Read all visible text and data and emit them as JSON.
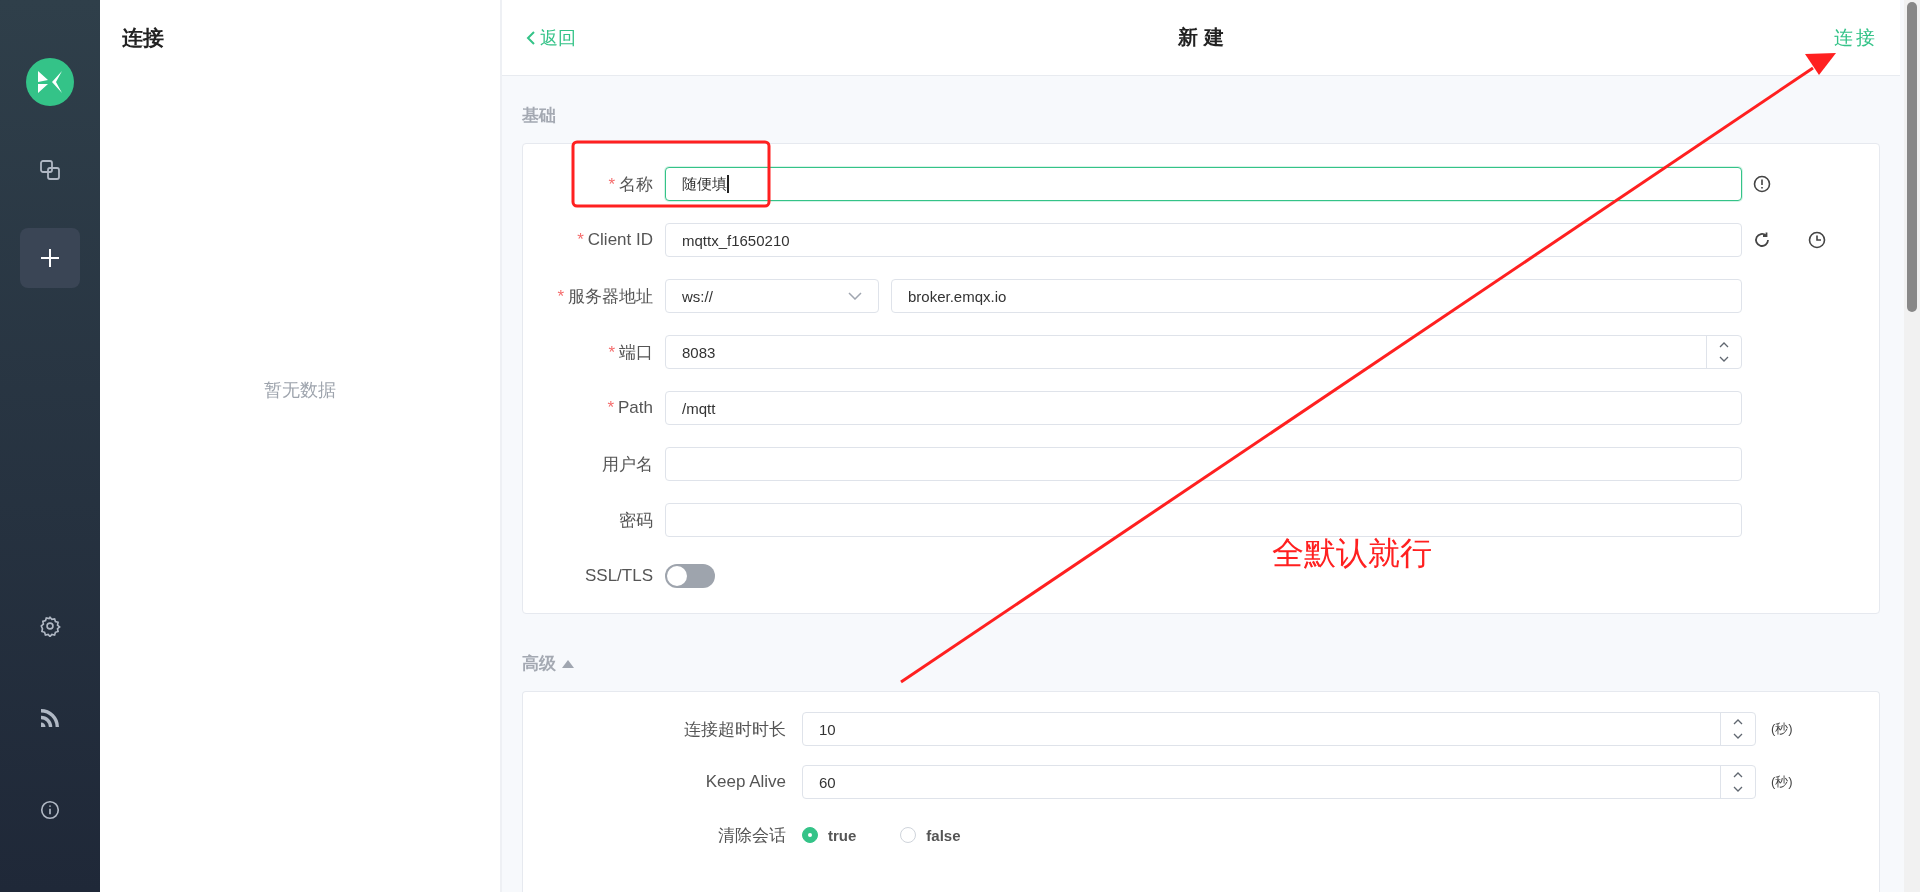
{
  "sidebar": {
    "top_nav": [
      {
        "kind": "connections",
        "selected": false
      },
      {
        "kind": "new",
        "selected": true
      }
    ],
    "bottom_nav": [
      {
        "kind": "settings",
        "selected": false
      },
      {
        "kind": "log",
        "selected": false
      },
      {
        "kind": "about",
        "selected": false
      }
    ]
  },
  "connections_panel": {
    "title": "连接",
    "empty_text": "暂无数据"
  },
  "header": {
    "back": "返回",
    "title": "新 建",
    "action": "连接"
  },
  "basic": {
    "title": "基础",
    "fields": [
      {
        "kind": "name",
        "label": "名称",
        "mark": "*",
        "value": "随便填",
        "focused": true
      },
      {
        "kind": "client_id",
        "label": "Client ID",
        "mark": "*",
        "value": "mqttx_f1650210"
      },
      {
        "kind": "protocol_host",
        "label": "服务器地址",
        "mark": "*",
        "protocol": "ws://",
        "value": "broker.emqx.io"
      },
      {
        "kind": "number",
        "label": "端口",
        "mark": "*",
        "value": "8083"
      },
      {
        "kind": "text",
        "label": "Path",
        "mark": "*",
        "value": "/mqtt"
      },
      {
        "kind": "text",
        "label": "用户名"
      },
      {
        "kind": "password",
        "label": "密码"
      },
      {
        "kind": "toggle",
        "label": "SSL/TLS",
        "on": false
      }
    ]
  },
  "advanced": {
    "title": "高级",
    "expanded": true,
    "fields": [
      {
        "kind": "number",
        "label": "连接超时时长",
        "value": "10",
        "unit": "(秒)"
      },
      {
        "kind": "number",
        "label": "Keep Alive",
        "value": "60",
        "unit": "(秒)"
      },
      {
        "kind": "radio",
        "label": "清除会话",
        "options": [
          {
            "label": "true",
            "selected": true
          },
          {
            "label": "false",
            "selected": false
          }
        ]
      }
    ]
  },
  "annotations": [
    {
      "kind": "box"
    },
    {
      "kind": "arrow"
    },
    {
      "kind": "note",
      "text": "全默认就行"
    }
  ]
}
